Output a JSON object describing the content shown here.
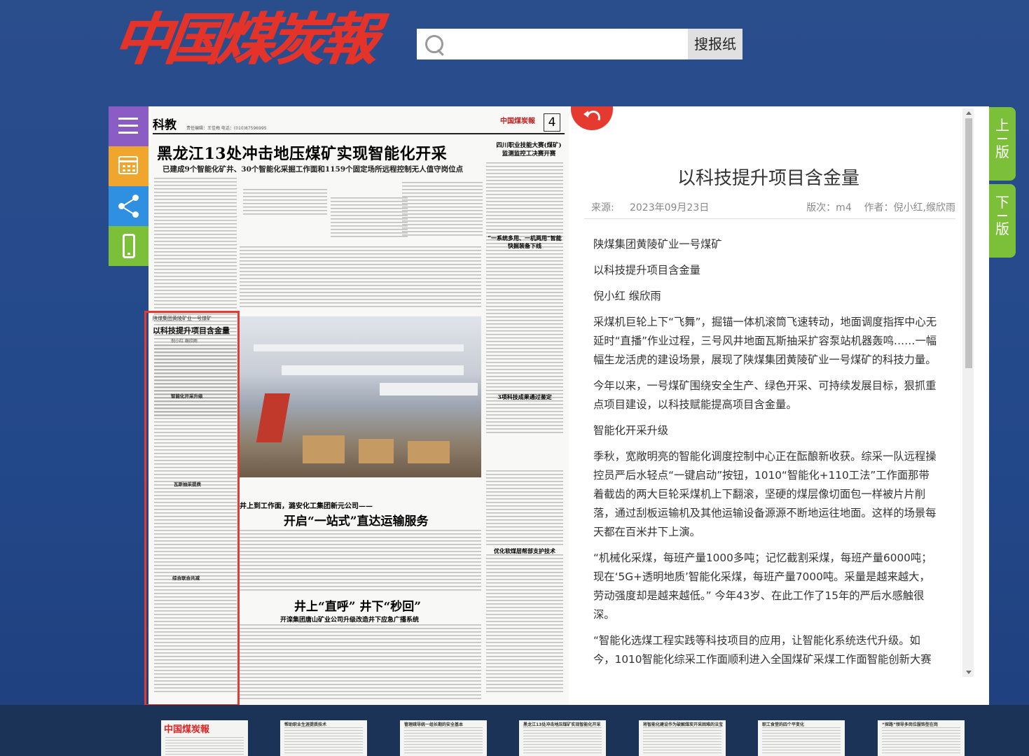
{
  "site": {
    "logo_text": "中国煤炭報",
    "search_placeholder": "",
    "search_button": "搜报纸"
  },
  "tools": {
    "menu_icon": "menu-icon",
    "calendar_icon": "calendar-icon",
    "share_icon": "share-icon",
    "mobile_icon": "mobile-icon"
  },
  "page": {
    "section": "科教",
    "editor_line": "责任编辑：王佳梅  电话：(010)87596995",
    "masthead": "中国煤炭報",
    "page_number": "4",
    "headline": "黑龙江13处冲击地压煤矿实现智能化开采",
    "subheadline": "已建成9个智能化矿井、30个智能化采掘工作面和1159个固定场所远程控制无人值守岗位点",
    "right_title": "四川职业技能大赛(煤矿)监测监控工决赛开赛",
    "right_sub1": "“一系统多用、一机两用”智能快掘装备下线",
    "right_sub2": "3项科技成果通过鉴定",
    "right_sub3": "优化软煤层帮部支护技术",
    "mid_title1": "开启“一站式”直达运输服务",
    "mid_kicker1": "井上到工作面，潞安化工集团新元公司——",
    "mid_title2": "井上“直呼” 井下“秒回”",
    "mid_sub2": "开滦集团唐山矿业公司升级改造井下应急广播系统",
    "highlight_kicker": "陕煤集团黄陵矿业一号煤矿",
    "highlight_title": "以科技提升项目含金量",
    "highlight_author": "倪小红  缑欣雨",
    "highlight_sub1": "智能化开采升级",
    "highlight_sub2": "瓦斯抽采提质",
    "highlight_sub3": "综合联合共减"
  },
  "article": {
    "title": "以科技提升项目含金量",
    "source_label": "来源:",
    "date": "2023年09月23日",
    "edition_label": "版次：m4",
    "author_label": "作者：倪小红,缑欣雨",
    "paragraphs": [
      "陕煤集团黄陵矿业一号煤矿",
      "以科技提升项目含金量",
      "倪小红 缑欣雨",
      "采煤机巨轮上下“飞舞”，掘锚一体机滚筒飞速转动，地面调度指挥中心无延时“直播”作业过程，三号风井地面瓦斯抽采扩容泵站机器轰鸣……一幅幅生龙活虎的建设场景，展现了陕煤集团黄陵矿业一号煤矿的科技力量。",
      "今年以来，一号煤矿围绕安全生产、绿色开采、可持续发展目标，狠抓重点项目建设，以科技赋能提高项目含金量。",
      "智能化开采升级",
      "季秋，宽敞明亮的智能化调度控制中心正在酝酿新收获。综采一队远程操控员严后水轻点“一键启动”按钮，1010“智能化+110工法”工作面那带着截齿的两大巨轮采煤机上下翻滚，坚硬的煤层像切面包一样被片片削落，通过刮板运输机及其他运输设备源源不断地运往地面。这样的场景每天都在百米井下上演。",
      "“机械化采煤，每班产量1000多吨；记忆截割采煤，每班产量6000吨；现在‘5G+透明地质’智能化采煤，每班产量7000吨。采量是越来越大，劳动强度却是越来越低。” 今年43岁、在此工作了15年的严后水感触很深。",
      "“智能化选煤工程实践等科技项目的应用，让智能化系统迭代升级。如今，1010智能化综采工作面顺利进入全国煤矿采煤工作面智能创新大赛"
    ]
  },
  "nav": {
    "prev_label_1": "上",
    "prev_label_2": "版",
    "next_label_1": "下",
    "next_label_2": "版",
    "back_icon": "back-arrow-icon"
  },
  "thumbnails": [
    {
      "label": "中国煤炭報"
    },
    {
      "label": "帮助职业生涯提质技术"
    },
    {
      "label": "管理疏导统一组长期的安全基本"
    },
    {
      "label": "黑龙江13处冲击地压煤矿实现智能化开采"
    },
    {
      "label": "将智能化建设作为破解煤炭开采困难的法宝"
    },
    {
      "label": "职工食堂的四个平变化"
    },
    {
      "label": "“探路”领导多岗位服饰型在岗"
    }
  ]
}
